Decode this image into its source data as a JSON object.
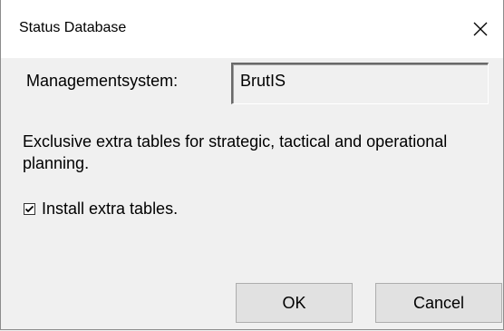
{
  "window": {
    "title": "Status Database",
    "close_icon": "close-icon"
  },
  "management": {
    "label": "Managementsystem:",
    "value": "BrutIS"
  },
  "description": "Exclusive extra tables for strategic, tactical and operational planning.",
  "checkbox": {
    "label": "Install extra tables.",
    "checked": true
  },
  "buttons": {
    "ok_label": "OK",
    "cancel_label": "Cancel"
  }
}
